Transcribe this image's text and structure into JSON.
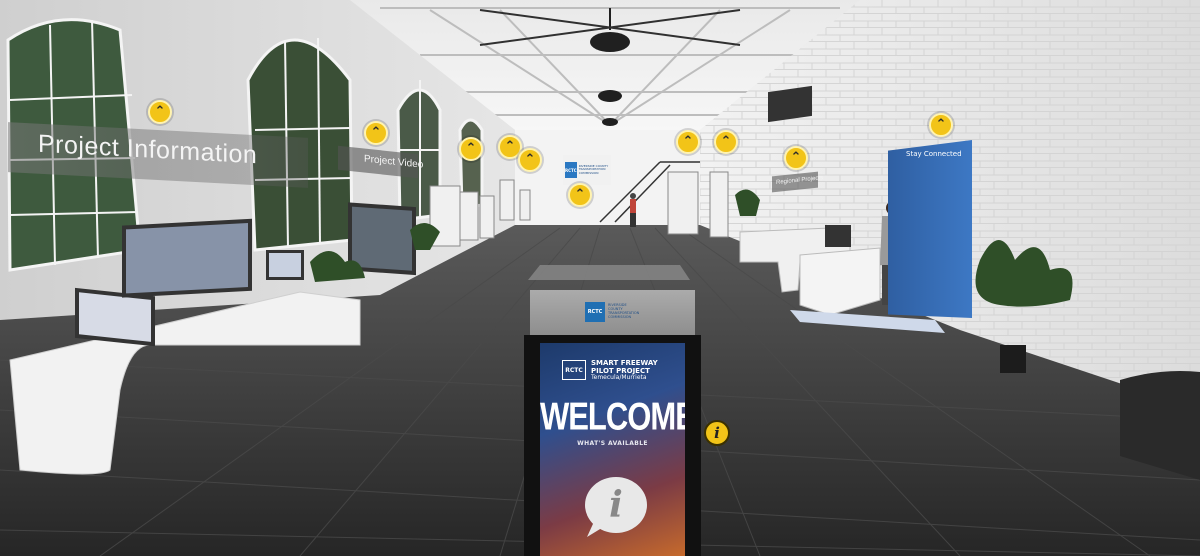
{
  "scene": {
    "type": "virtual-exhibition-hall"
  },
  "signs": {
    "project_information": "Project Information",
    "project_video": "Project Video",
    "regional_projects": "Regional Projects",
    "stay_connected": "Stay Connected"
  },
  "banner": {
    "logo_abbr": "RCTC",
    "org_lines": "RIVERSIDE COUNTY TRANSPORTATION COMMISSION"
  },
  "kiosk": {
    "logo_abbr": "RCTC",
    "org_lines": "RIVERSIDE COUNTY TRANSPORTATION COMMISSION",
    "brand_abbr": "RCTC",
    "brand_line1": "SMART FREEWAY",
    "brand_line2": "PILOT PROJECT",
    "brand_line3": "Temecula/Murrieta",
    "heading": "WELCOME",
    "subheading": "WHAT'S AVAILABLE",
    "info_glyph": "i"
  },
  "hotspots": {
    "glyph": "⌃",
    "info_glyph": "i"
  },
  "colors": {
    "hotspot": "#f2c418",
    "brand_blue": "#2a78c2"
  }
}
